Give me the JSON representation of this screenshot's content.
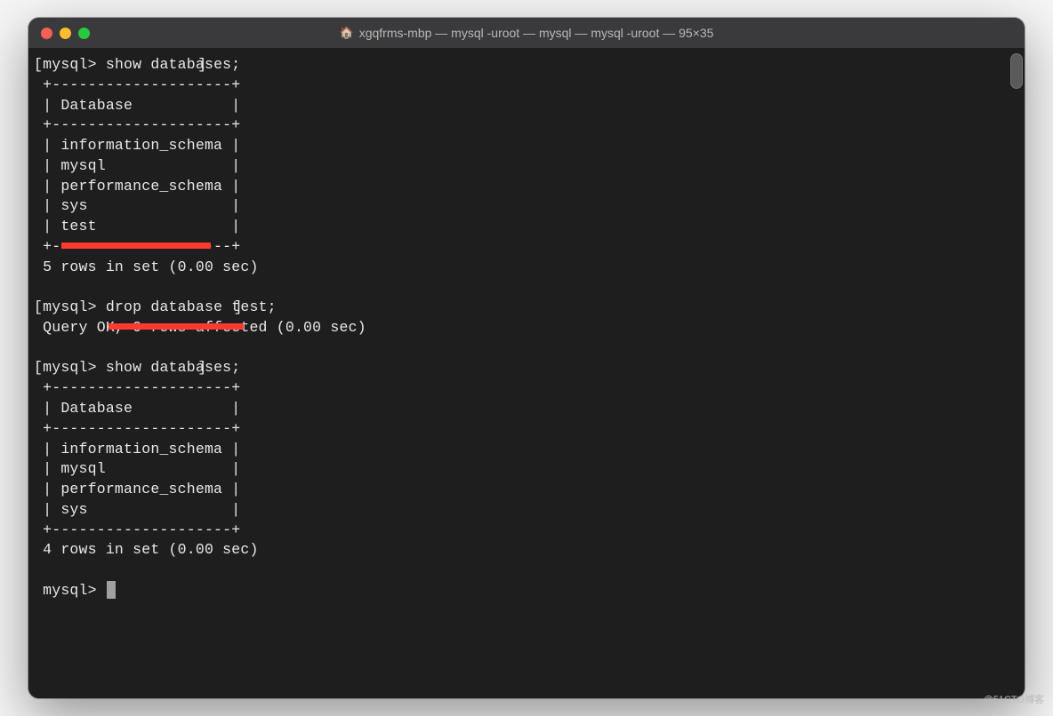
{
  "window": {
    "title": "xgqfrms-mbp — mysql -uroot — mysql — mysql -uroot — 95×35"
  },
  "terminal": {
    "prompt": "mysql>",
    "lines": {
      "cmd1": "show databases;",
      "sep1": "+--------------------+",
      "hdr1": "| Database           |",
      "sep2": "+--------------------+",
      "row1": "| information_schema |",
      "row2": "| mysql              |",
      "row3": "| performance_schema |",
      "row4": "| sys                |",
      "row5": "| test               |",
      "sep3": "+--------------------+",
      "res1": "5 rows in set (0.00 sec)",
      "cmd2": "drop database test;",
      "res2": "Query OK, 0 rows affected (0.00 sec)",
      "cmd3": "show databases;",
      "sep4": "+--------------------+",
      "hdr2": "| Database           |",
      "sep5": "+--------------------+",
      "row6": "| information_schema |",
      "row7": "| mysql              |",
      "row8": "| performance_schema |",
      "row9": "| sys                |",
      "sep6": "+--------------------+",
      "res3": "4 rows in set (0.00 sec)"
    }
  },
  "watermark": "@51CTO博客"
}
